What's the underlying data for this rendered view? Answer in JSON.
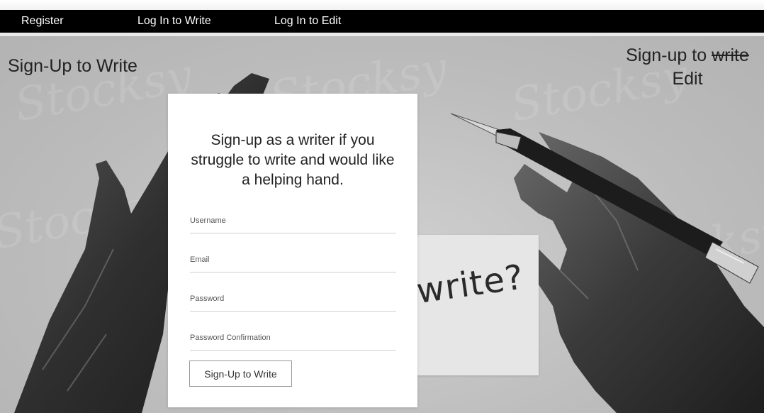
{
  "nav": {
    "items": [
      {
        "label": "Register"
      },
      {
        "label": "Log In to Write"
      },
      {
        "label": "Log In to Edit"
      }
    ]
  },
  "hero": {
    "left_title": "Sign-Up to Write",
    "right_title_prefix": "Sign-up to",
    "right_title_struck": "write",
    "right_title_suffix": "Edit",
    "note_text": "write?",
    "watermark_text": "Stocksy"
  },
  "form": {
    "heading": "Sign-up as a writer if you struggle to write and would like a helping hand.",
    "username_placeholder": "Username",
    "email_placeholder": "Email",
    "password_placeholder": "Password",
    "password_confirmation_placeholder": "Password Confirmation",
    "submit_label": "Sign-Up to Write"
  },
  "colors": {
    "navbar": "#000000",
    "background": "#bdbdbd",
    "card": "#ffffff"
  }
}
